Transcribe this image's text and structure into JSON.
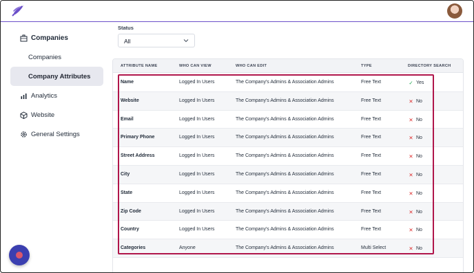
{
  "sidebar": {
    "companies_section": "Companies",
    "companies": "Companies",
    "company_attributes": "Company Attributes",
    "analytics": "Analytics",
    "website": "Website",
    "general_settings": "General Settings"
  },
  "filter": {
    "label": "Status",
    "value": "All"
  },
  "table": {
    "headers": [
      "ATTRIBUTE NAME",
      "WHO CAN VIEW",
      "WHO CAN EDIT",
      "TYPE",
      "DIRECTORY SEARCH"
    ],
    "rows": [
      {
        "name": "Name",
        "view": "Logged In Users",
        "edit": "The Company's Admins & Association Admins",
        "type": "Free Text",
        "search": "Yes"
      },
      {
        "name": "Website",
        "view": "Logged In Users",
        "edit": "The Company's Admins & Association Admins",
        "type": "Free Text",
        "search": "No"
      },
      {
        "name": "Email",
        "view": "Logged In Users",
        "edit": "The Company's Admins & Association Admins",
        "type": "Free Text",
        "search": "No"
      },
      {
        "name": "Primary Phone",
        "view": "Logged In Users",
        "edit": "The Company's Admins & Association Admins",
        "type": "Free Text",
        "search": "No"
      },
      {
        "name": "Street Address",
        "view": "Logged In Users",
        "edit": "The Company's Admins & Association Admins",
        "type": "Free Text",
        "search": "No"
      },
      {
        "name": "City",
        "view": "Logged In Users",
        "edit": "The Company's Admins & Association Admins",
        "type": "Free Text",
        "search": "No"
      },
      {
        "name": "State",
        "view": "Logged In Users",
        "edit": "The Company's Admins & Association Admins",
        "type": "Free Text",
        "search": "No"
      },
      {
        "name": "Zip Code",
        "view": "Logged In Users",
        "edit": "The Company's Admins & Association Admins",
        "type": "Free Text",
        "search": "No"
      },
      {
        "name": "Country",
        "view": "Logged In Users",
        "edit": "The Company's Admins & Association Admins",
        "type": "Free Text",
        "search": "No"
      },
      {
        "name": "Categories",
        "view": "Anyone",
        "edit": "The Company's Admins & Association Admins",
        "type": "Multi Select",
        "search": "No"
      }
    ]
  },
  "colors": {
    "accent": "#6b4fc9",
    "highlight": "#b0154a",
    "yes": "#16a34a",
    "no": "#dc2626"
  },
  "icons": {
    "logo": "feather-logo-icon",
    "companies": "building-icon",
    "analytics": "bar-chart-icon",
    "website": "cube-icon",
    "settings": "gear-icon",
    "chat": "chat-launcher-icon"
  }
}
